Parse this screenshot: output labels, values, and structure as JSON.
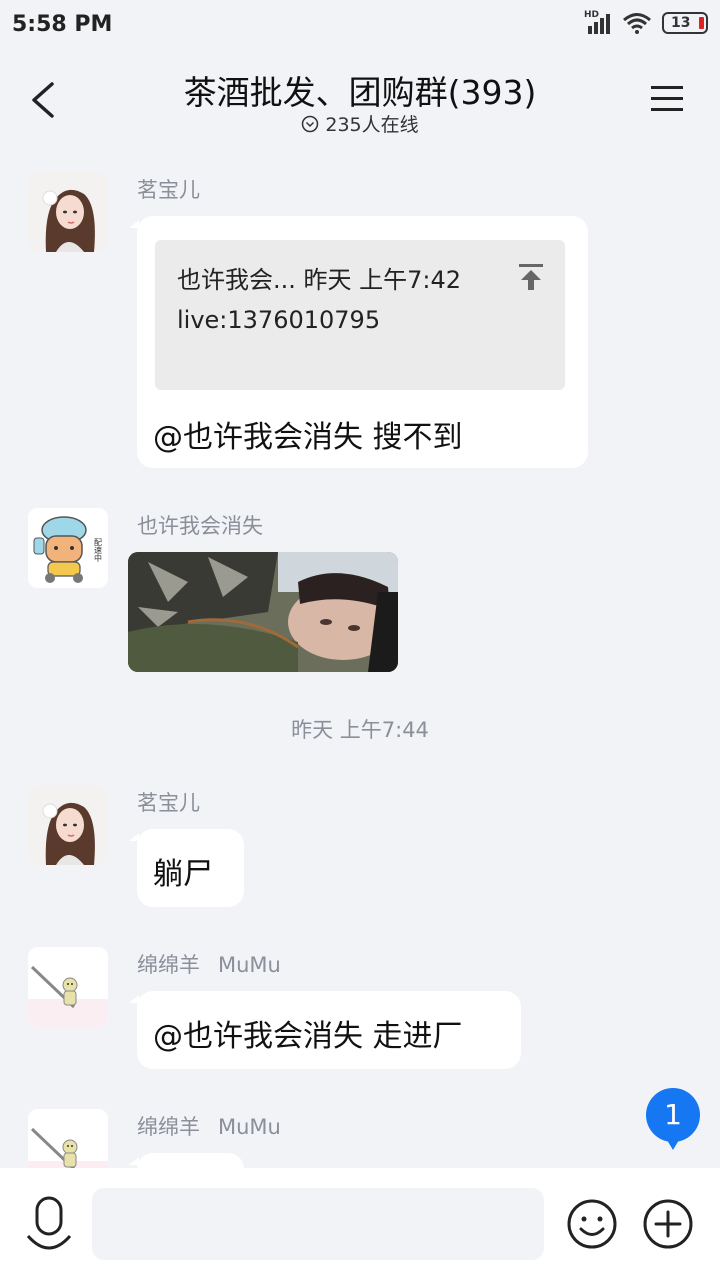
{
  "status_bar": {
    "time": "5:58 PM",
    "network": "HD",
    "battery": "13"
  },
  "header": {
    "title": "茶酒批发、团购群(393)",
    "online": "235人在线"
  },
  "messages": [
    {
      "sender": "茗宝儿",
      "reply": {
        "head": "也许我会... 昨天 上午7:42",
        "body": "live:1376010795"
      },
      "text": "@也许我会消失 搜不到"
    },
    {
      "sender": "也许我会消失",
      "type": "image"
    },
    {
      "sender": "茗宝儿",
      "text": "躺尸"
    },
    {
      "sender": "绵绵羊",
      "sender_extra": "MuMu",
      "text": "@也许我会消失 走进厂"
    },
    {
      "sender": "绵绵羊",
      "sender_extra": "MuMu",
      "text": ""
    }
  ],
  "timestamp": "昨天 上午7:44",
  "unread_count": "1",
  "input": {
    "placeholder": ""
  },
  "icons": {
    "back": "back-arrow-icon",
    "menu": "hamburger-menu-icon",
    "online": "chevron-circle-icon",
    "voice": "microphone-icon",
    "emoji": "smiley-icon",
    "plus": "plus-circle-icon"
  },
  "colors": {
    "accent": "#1677f2",
    "background": "#f2f3f7",
    "secondary_text": "#8a8f99"
  }
}
